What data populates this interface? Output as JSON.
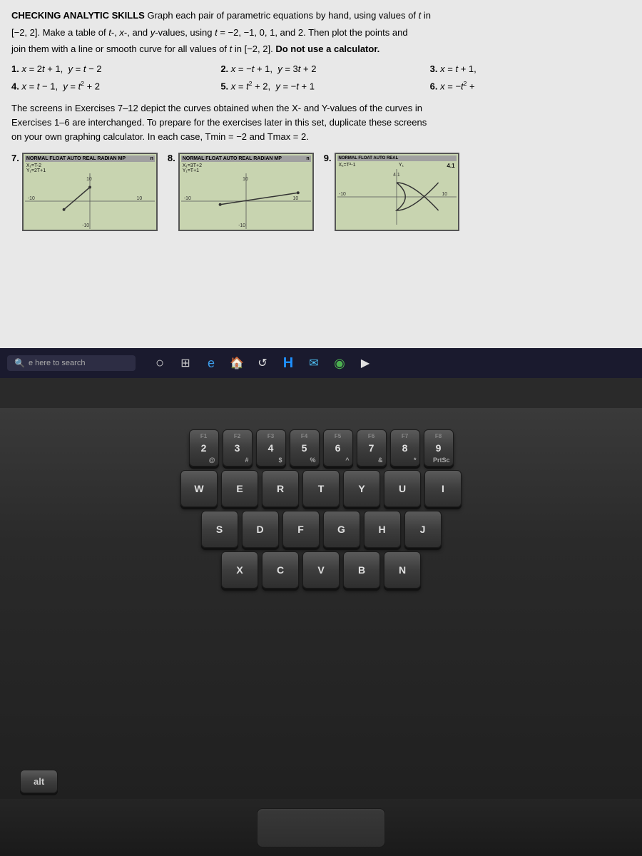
{
  "screen": {
    "section_label": "CHECKING ANALYTIC SKILLS",
    "intro_text": "Graph each pair of parametric equations by hand, using values of t in [−2, 2]. Make a table of t-, x-, and y-values, using t = −2, −1, 0, 1, and 2. Then plot the points and join them with a line or smooth curve for all values of t in [−2, 2].",
    "no_calc": "Do not use a calculator.",
    "problems": [
      {
        "num": "1.",
        "eq": "x = 2t + 1,  y = t − 2"
      },
      {
        "num": "2.",
        "eq": "x = −t + 1,  y = 3t + 2"
      },
      {
        "num": "3.",
        "eq": "x = t + 1,"
      },
      {
        "num": "4.",
        "eq": "x = t − 1,  y = t² + 2"
      },
      {
        "num": "5.",
        "eq": "x = t² + 2,  y = −t + 1"
      },
      {
        "num": "6.",
        "eq": "x = −t² +"
      }
    ],
    "middle_text_1": "The screens in Exercises 7–12 depict the curves obtained when the X- and Y-values of the curves in Exercises 1–6 are interchanged. To prepare for the exercises later in this set, duplicate these screens on your own graphing calculator. In each case, Tmin = −2 and Tmax = 2.",
    "calc_screens": [
      {
        "number": "7.",
        "header": "NORMAL FLOAT AUTO REAL RADIAN MP",
        "label_x": "X₁=T-2",
        "label_y": "Y₁=2T+1",
        "axis_range": "10"
      },
      {
        "number": "8.",
        "header": "NORMAL FLOAT AUTO REAL RADIAN MP",
        "label_x": "X₁=3T+2",
        "label_y": "Y₁=T+1",
        "axis_range": "10"
      },
      {
        "number": "9.",
        "header": "NORMAL FLOAT AUTO REAL",
        "label_x": "X₁=T²-1",
        "label_y": "Y₁",
        "axis_range": "4.1"
      }
    ]
  },
  "taskbar": {
    "search_placeholder": "e here to search",
    "icons": [
      {
        "name": "circle",
        "symbol": "○"
      },
      {
        "name": "grid",
        "symbol": "⊞"
      },
      {
        "name": "edge",
        "symbol": "e"
      },
      {
        "name": "taskbar-icon-4",
        "symbol": "🔴"
      },
      {
        "name": "refresh",
        "symbol": "↺"
      },
      {
        "name": "microsoft-h",
        "symbol": "H"
      },
      {
        "name": "mail",
        "symbol": "✉"
      },
      {
        "name": "chrome",
        "symbol": "◉"
      },
      {
        "name": "play",
        "symbol": "▶"
      }
    ]
  },
  "keyboard": {
    "rows": [
      [
        {
          "label": "2",
          "sub": "@",
          "fn": "F1"
        },
        {
          "label": "3",
          "sub": "#",
          "fn": "F2"
        },
        {
          "label": "4",
          "sub": "$",
          "fn": "F3"
        },
        {
          "label": "5",
          "sub": "%",
          "fn": "F4"
        },
        {
          "label": "6",
          "sub": "^",
          "fn": "F5"
        },
        {
          "label": "7",
          "sub": "&",
          "fn": "F6"
        },
        {
          "label": "8",
          "sub": "*",
          "fn": "F7"
        },
        {
          "label": "9",
          "sub": "PrtSc",
          "fn": "F8"
        }
      ],
      [
        {
          "label": "W"
        },
        {
          "label": "E"
        },
        {
          "label": "R"
        },
        {
          "label": "T"
        },
        {
          "label": "Y"
        },
        {
          "label": "U"
        },
        {
          "label": "I"
        }
      ],
      [
        {
          "label": "S"
        },
        {
          "label": "D"
        },
        {
          "label": "F"
        },
        {
          "label": "G"
        },
        {
          "label": "H"
        },
        {
          "label": "J"
        }
      ],
      [
        {
          "label": "X"
        },
        {
          "label": "C"
        },
        {
          "label": "V"
        },
        {
          "label": "B"
        },
        {
          "label": "N"
        }
      ]
    ],
    "alt_label": "alt"
  }
}
